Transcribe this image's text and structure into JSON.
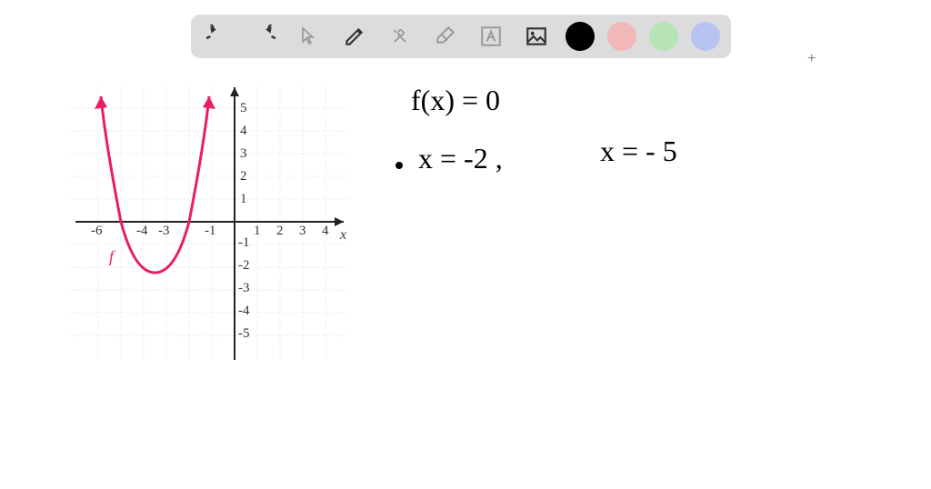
{
  "toolbar": {
    "undo": "↺",
    "redo": "↻",
    "pointer": "pointer-icon",
    "pencil": "pencil-icon",
    "tools": "tools-icon",
    "eraser": "eraser-icon",
    "text": "text-icon",
    "image": "image-icon",
    "colors": {
      "black": "#000000",
      "red": "#f2b7b7",
      "green": "#b7e4b7",
      "blue": "#b7c4f2"
    }
  },
  "handwriting": {
    "line1": "f(x) = 0",
    "line2a": "x = -2 ,",
    "line2b": "x = - 5"
  },
  "graph": {
    "x_label": "x",
    "f_label": "f",
    "x_ticks_neg": [
      "-6",
      "",
      "-4",
      "-3",
      "",
      "-1"
    ],
    "x_ticks_pos": [
      "1",
      "2",
      "3",
      "4"
    ],
    "y_ticks_pos": [
      "5",
      "4",
      "3",
      "2",
      "1"
    ],
    "y_ticks_neg": [
      "-1",
      "-2",
      "-3",
      "-4",
      "-5"
    ]
  },
  "chart_data": {
    "type": "line",
    "title": "",
    "xlabel": "x",
    "ylabel": "",
    "xlim": [
      -6.5,
      4.5
    ],
    "ylim": [
      -5.5,
      5.5
    ],
    "series": [
      {
        "name": "f",
        "color": "#e91e63",
        "x": [
          -6,
          -5,
          -4,
          -3.5,
          -3,
          -2,
          -1
        ],
        "values": [
          5.8,
          0,
          -2,
          -2.25,
          -2,
          0,
          5.8
        ]
      }
    ],
    "annotations": [
      {
        "text": "f",
        "x": -5.1,
        "y": -1.6
      }
    ],
    "roots": [
      -5,
      -2
    ],
    "vertex": {
      "x": -3.5,
      "y": -2.25
    }
  },
  "misc": {
    "plus": "+"
  }
}
